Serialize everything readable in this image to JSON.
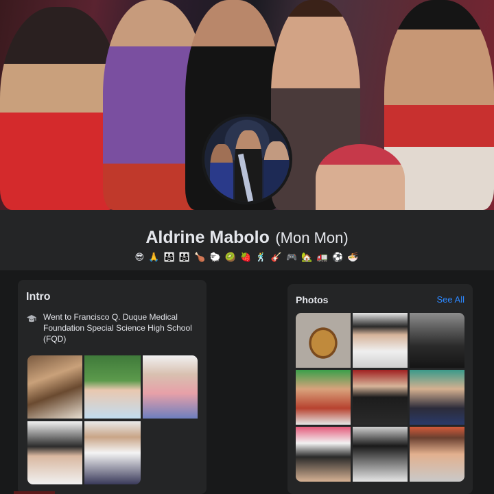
{
  "profile": {
    "name": "Aldrine Mabolo",
    "alternate_name": "(Mon Mon)",
    "bio_emojis": "😎 🙏 👨‍👩‍👧 👨‍👩‍👧 🍗 🐑 🥝 🍓 🕺 🎸 🎮 🏡 🚛 ⚽ 🍜"
  },
  "intro": {
    "title": "Intro",
    "education": "Went to Francisco Q. Duque Medical Foundation Special Science High School (FQD)",
    "education_icon": "graduation-cap-icon"
  },
  "photos": {
    "title": "Photos",
    "see_all": "See All",
    "link_color": "#2d88ff"
  },
  "colors": {
    "background": "#18191a",
    "card": "#242526",
    "text": "#e4e6eb"
  }
}
